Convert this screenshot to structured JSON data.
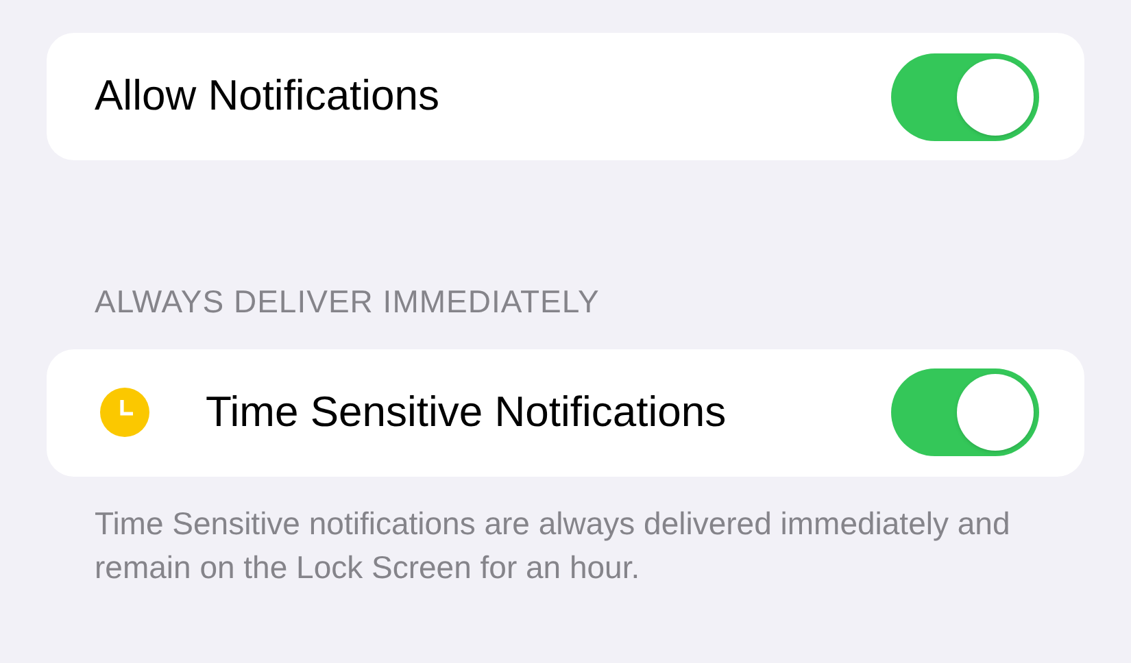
{
  "allow_notifications": {
    "label": "Allow Notifications",
    "on": true
  },
  "section": {
    "header": "ALWAYS DELIVER IMMEDIATELY",
    "row": {
      "label": "Time Sensitive Notifications",
      "on": true
    },
    "footer": "Time Sensitive notifications are always delivered immediately and remain on the Lock Screen for an hour."
  }
}
